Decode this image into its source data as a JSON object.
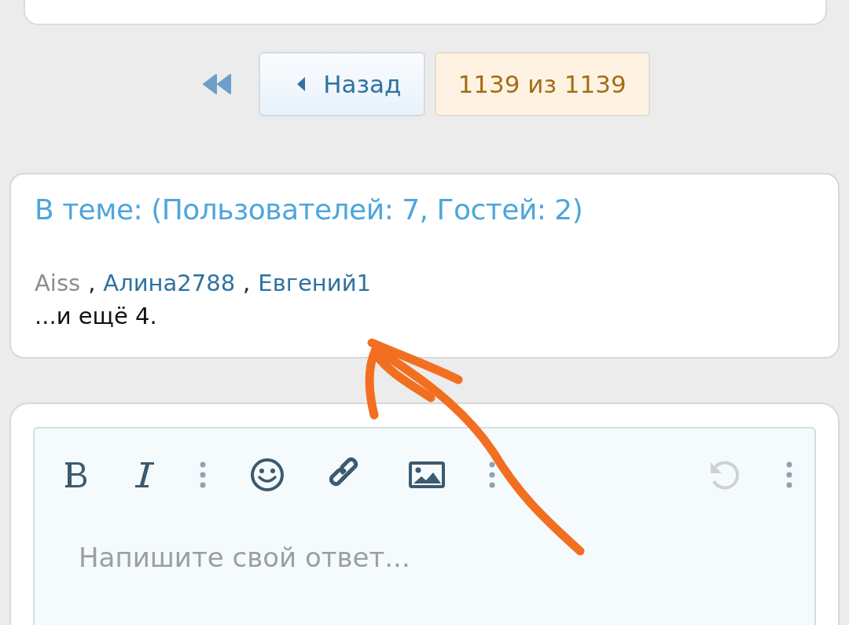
{
  "pagination": {
    "back": "Назад",
    "pages": "1139 из 1139"
  },
  "online": {
    "title": "В теме: (Пользователей: 7, Гостей: 2)",
    "users": [
      {
        "name": "Aiss",
        "color": "#8c8c8c"
      },
      {
        "name": "Алина2788",
        "color": "#2f72a0"
      },
      {
        "name": "Евгений1",
        "color": "#2f72a0"
      }
    ],
    "separator": ",",
    "more": "...и ещё 4."
  },
  "editor": {
    "tools": [
      {
        "kind": "bold",
        "disabled": false
      },
      {
        "kind": "italic",
        "disabled": false
      },
      {
        "kind": "more",
        "disabled": false
      },
      {
        "kind": "emoji",
        "disabled": false
      },
      {
        "kind": "link",
        "disabled": false
      },
      {
        "kind": "image",
        "disabled": false
      },
      {
        "kind": "more",
        "disabled": false
      }
    ],
    "right_tools": [
      {
        "kind": "undo",
        "disabled": true
      },
      {
        "kind": "more",
        "disabled": false
      }
    ],
    "placeholder": "Напишите свой ответ..."
  }
}
